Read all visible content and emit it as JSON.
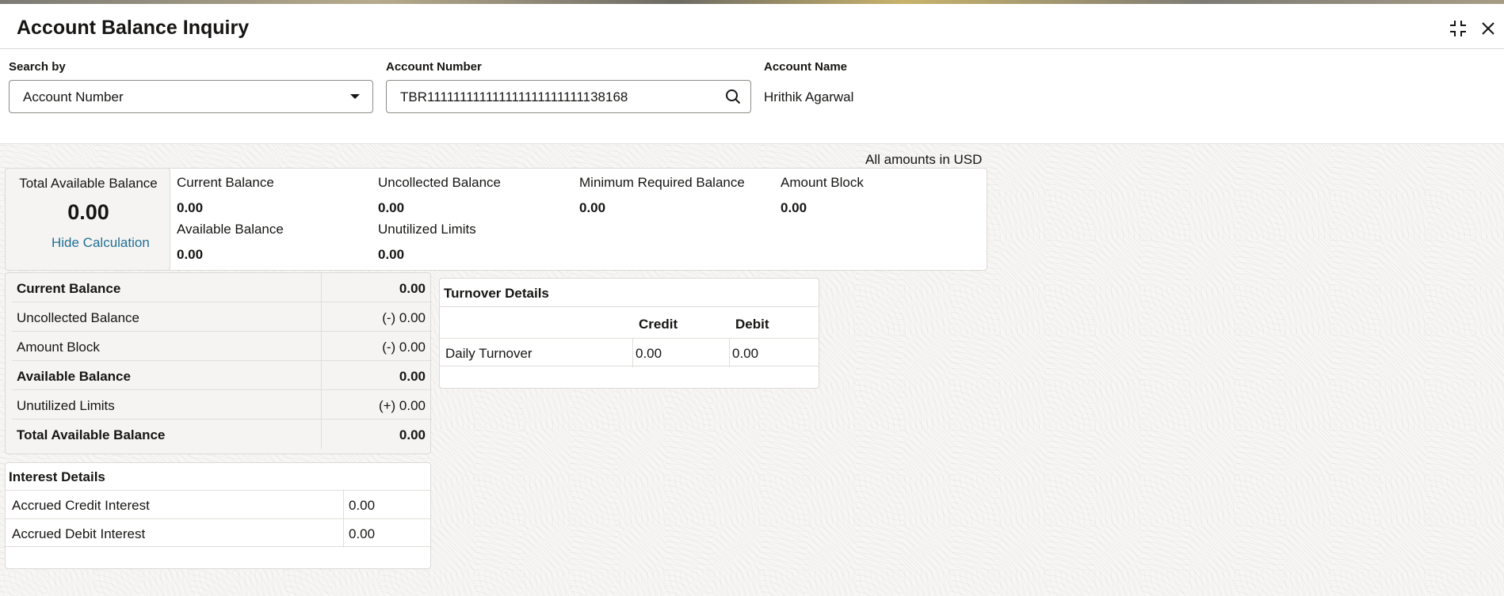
{
  "window": {
    "title": "Account Balance Inquiry"
  },
  "search": {
    "search_by_label": "Search by",
    "search_by_value": "Account Number",
    "account_number_label": "Account Number",
    "account_number_value": "TBR111111111111111111111111138168",
    "account_name_label": "Account Name",
    "account_name_value": "Hrithik Agarwal"
  },
  "amounts_note": "All amounts in USD",
  "summary": {
    "total_label": "Total Available Balance",
    "total_value": "0.00",
    "hide_calc_label": "Hide Calculation",
    "items": [
      {
        "label": "Current Balance",
        "value": "0.00"
      },
      {
        "label": "Uncollected Balance",
        "value": "0.00"
      },
      {
        "label": "Minimum Required Balance",
        "value": "0.00"
      },
      {
        "label": "Amount Block",
        "value": "0.00"
      },
      {
        "label": "Available Balance",
        "value": "0.00"
      },
      {
        "label": "Unutilized Limits",
        "value": "0.00"
      }
    ]
  },
  "calculation": [
    {
      "label": "Current Balance",
      "value": "0.00",
      "bold": true
    },
    {
      "label": "Uncollected Balance",
      "value": "(-) 0.00",
      "bold": false
    },
    {
      "label": "Amount Block",
      "value": "(-) 0.00",
      "bold": false
    },
    {
      "label": "Available Balance",
      "value": "0.00",
      "bold": true
    },
    {
      "label": "Unutilized Limits",
      "value": "(+) 0.00",
      "bold": false
    },
    {
      "label": "Total Available Balance",
      "value": "0.00",
      "bold": true
    }
  ],
  "interest": {
    "title": "Interest Details",
    "rows": [
      {
        "label": "Accrued Credit Interest",
        "value": "0.00"
      },
      {
        "label": "Accrued Debit Interest",
        "value": "0.00"
      }
    ]
  },
  "turnover": {
    "title": "Turnover Details",
    "columns": [
      "Credit",
      "Debit"
    ],
    "rows": [
      {
        "label": "Daily Turnover",
        "credit": "0.00",
        "debit": "0.00"
      }
    ]
  },
  "icons": {
    "collapse": "collapse-icon",
    "close": "close-icon",
    "dropdown": "caret-down-icon",
    "search": "search-icon"
  },
  "colors": {
    "link": "#227096",
    "text": "#161513",
    "border": "#dcdad6"
  }
}
